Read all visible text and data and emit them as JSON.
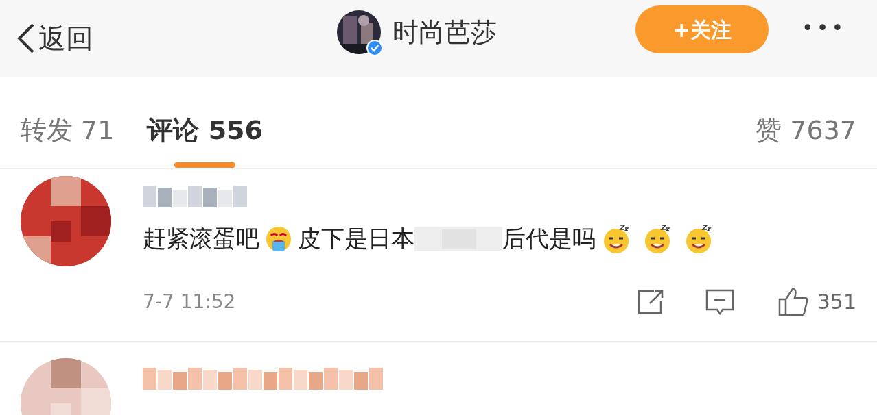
{
  "header": {
    "back_label": "返回",
    "title": "时尚芭莎",
    "verified": true,
    "follow_button": "+关注",
    "more": "•••"
  },
  "tabs": [
    {
      "label": "转发 71",
      "selected": false
    },
    {
      "label": "评论 556",
      "selected": true
    }
  ],
  "likes_tab": {
    "label": "赞 7637",
    "selected": false
  },
  "comments": [
    {
      "name_redacted": true,
      "segments": [
        {
          "kind": "text",
          "text": "赶紧滚蛋吧"
        },
        {
          "kind": "crying_emoji"
        },
        {
          "kind": "text",
          "text": "皮下是日本"
        },
        {
          "kind": "redacted"
        },
        {
          "kind": "text",
          "text": "后代是吗"
        },
        {
          "kind": "smirk_emoji"
        },
        {
          "kind": "smirk_emoji"
        },
        {
          "kind": "smirk_emoji"
        }
      ],
      "time": "7-7 11:52",
      "like_count": "351"
    },
    {
      "name_redacted": true
    }
  ]
}
